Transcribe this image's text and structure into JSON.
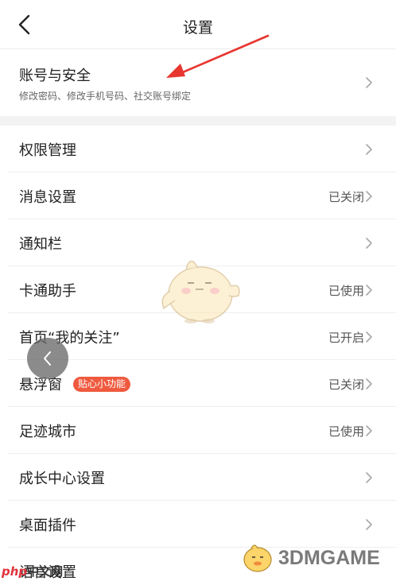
{
  "header": {
    "title": "设置"
  },
  "account": {
    "label": "账号与安全",
    "sublabel": "修改密码、修改手机号码、社交账号绑定"
  },
  "settings": [
    {
      "label": "权限管理",
      "status": ""
    },
    {
      "label": "消息设置",
      "status": "已关闭"
    },
    {
      "label": "通知栏",
      "status": ""
    },
    {
      "label": "卡通助手",
      "status": "已使用"
    },
    {
      "label": "首页“我的关注”",
      "status": "已开启"
    },
    {
      "label": "悬浮窗",
      "status": "已关闭",
      "badge": "贴心小功能"
    },
    {
      "label": "足迹城市",
      "status": "已使用"
    },
    {
      "label": "成长中心设置",
      "status": ""
    },
    {
      "label": "桌面插件",
      "status": ""
    },
    {
      "label": "语言设置",
      "status": ""
    }
  ],
  "watermarks": {
    "left_php": "php",
    "left_cn": "中文网",
    "right": "3DMGAME"
  },
  "colors": {
    "badge": "#ef5a3f",
    "arrow": "#e8352f",
    "chevron": "#a8a8a8"
  }
}
